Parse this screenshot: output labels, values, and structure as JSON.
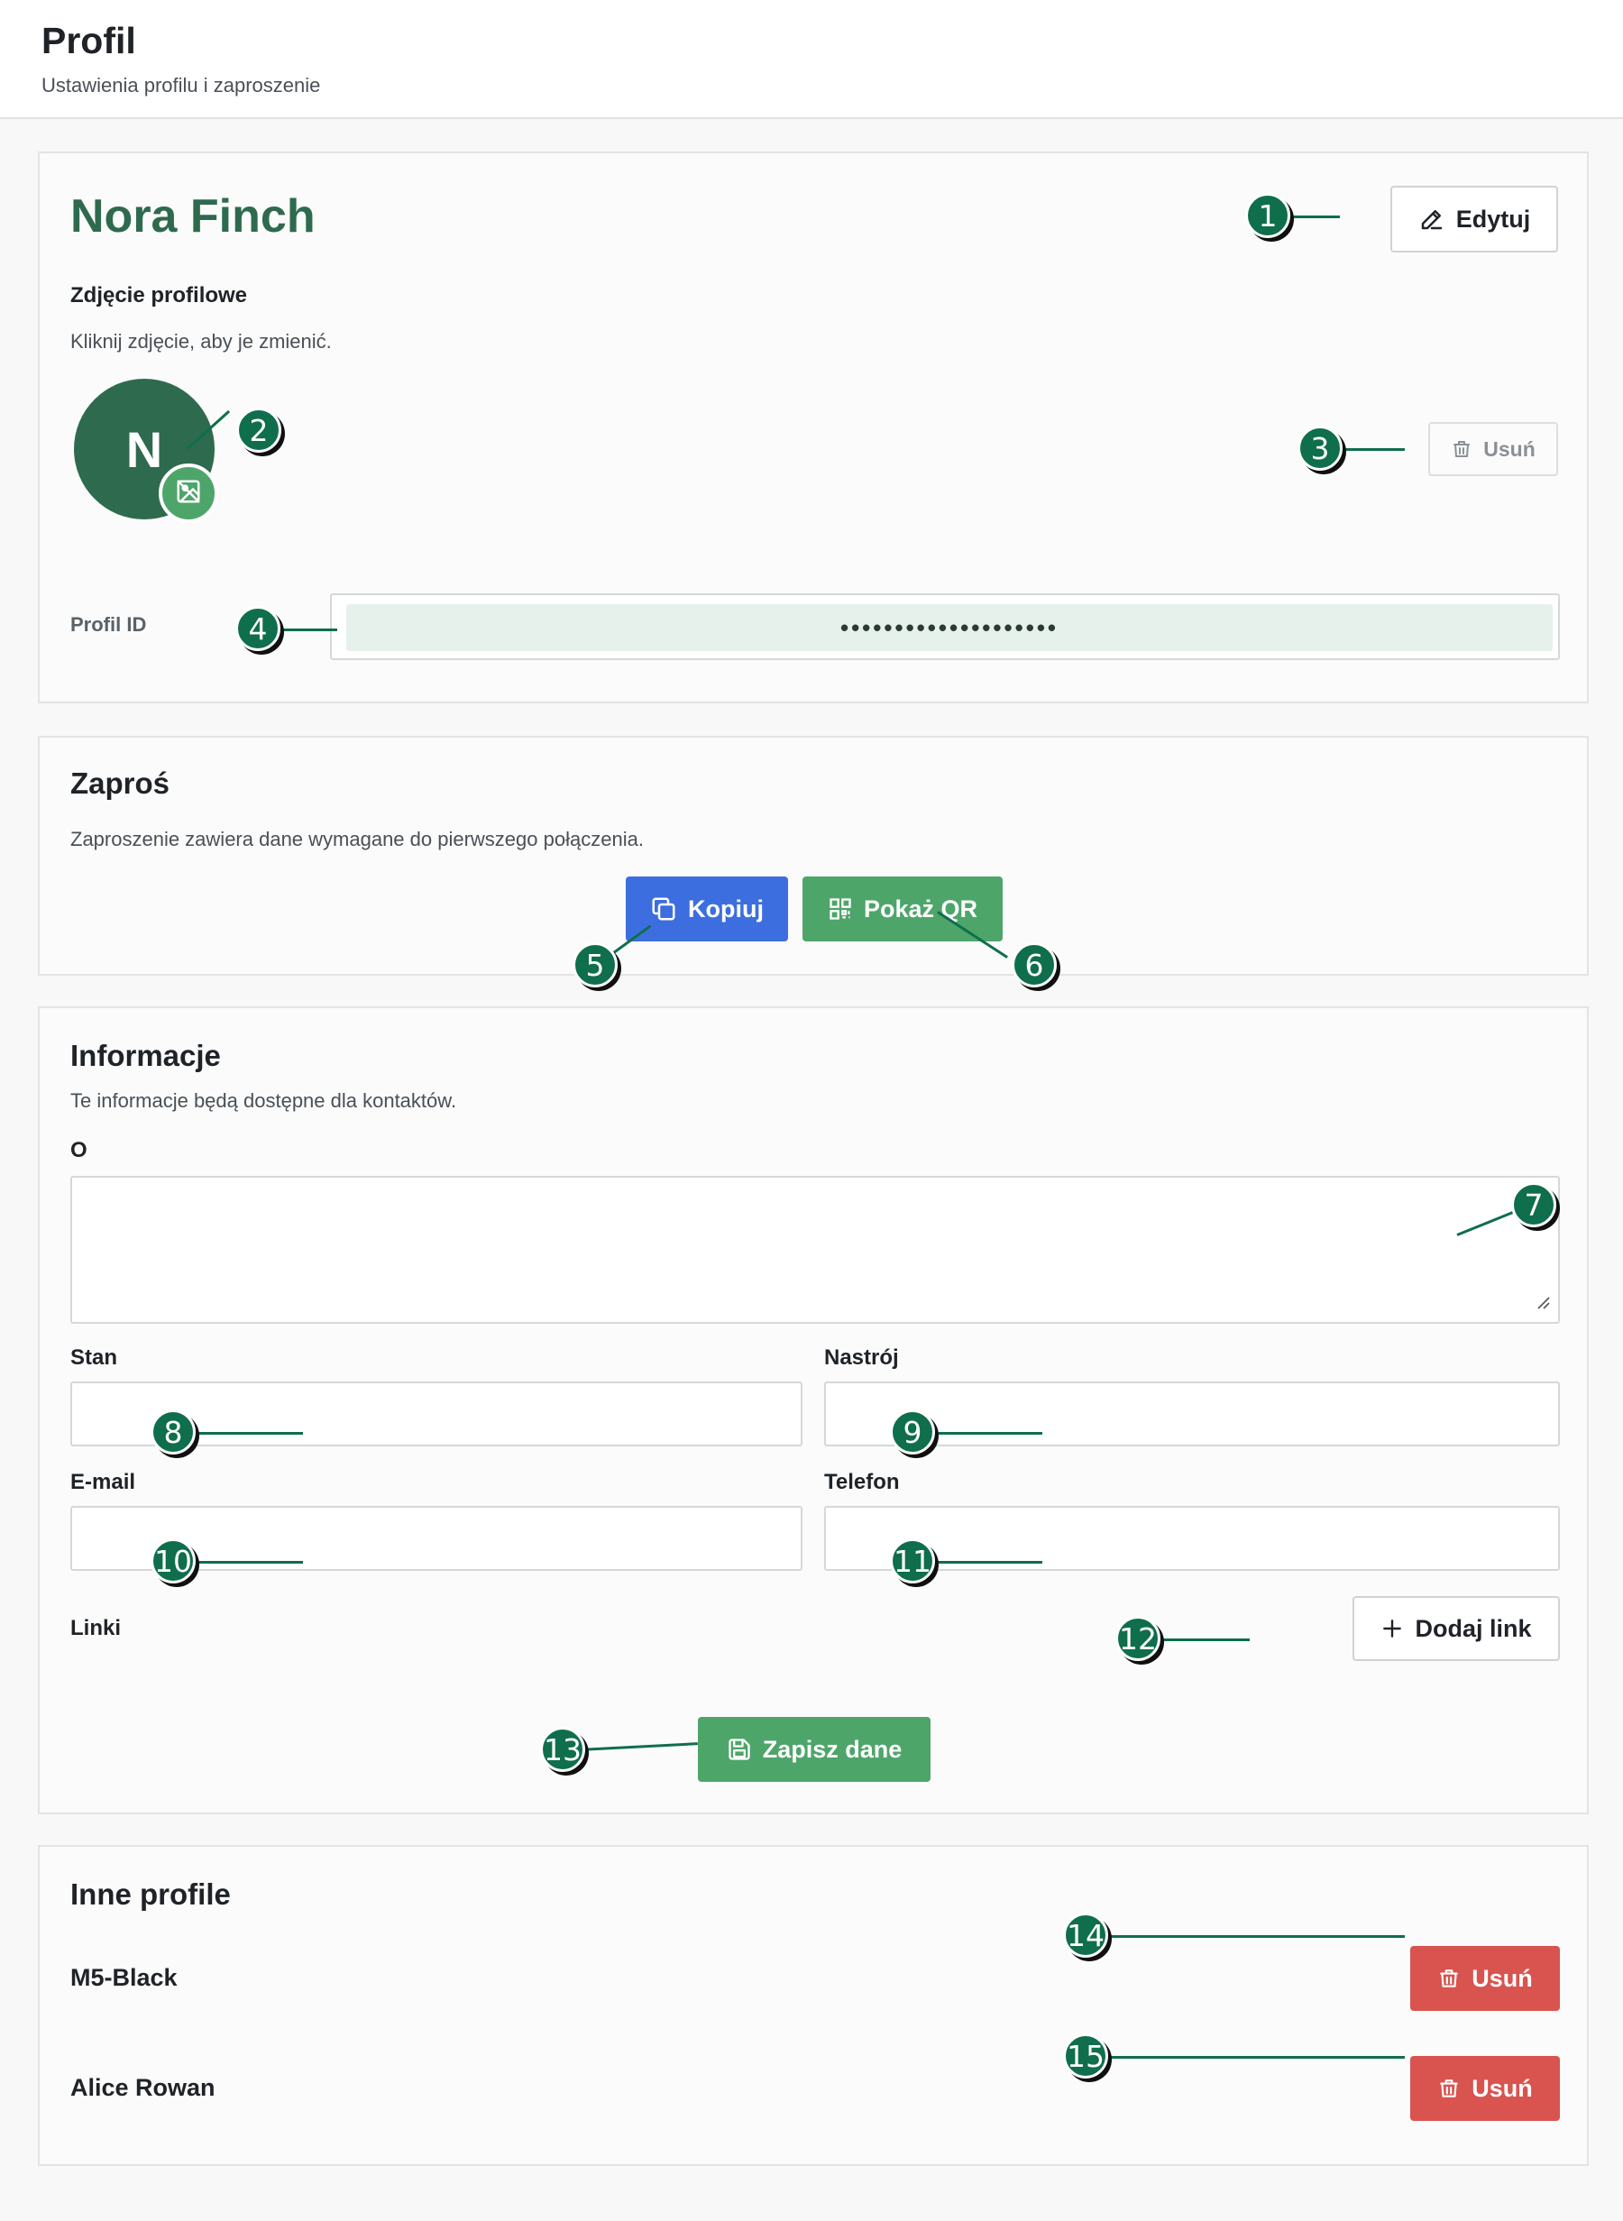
{
  "header": {
    "title": "Profil",
    "subtitle": "Ustawienia profilu i zaproszenie"
  },
  "profile": {
    "name": "Nora Finch",
    "edit_label": "Edytuj",
    "photo_heading": "Zdjęcie profilowe",
    "photo_hint": "Kliknij zdjęcie, aby je zmienić.",
    "avatar_initial": "N",
    "remove_photo_label": "Usuń",
    "id_label": "Profil ID",
    "id_value": "••••••••••••••••••••"
  },
  "invite": {
    "heading": "Zaproś",
    "description": "Zaproszenie zawiera dane wymagane do pierwszego połączenia.",
    "copy_label": "Kopiuj",
    "qr_label": "Pokaż QR"
  },
  "info": {
    "heading": "Informacje",
    "description": "Te informacje będą dostępne dla kontaktów.",
    "about_label": "O",
    "about_value": "",
    "status_label": "Stan",
    "status_value": "",
    "mood_label": "Nastrój",
    "mood_value": "",
    "email_label": "E-mail",
    "email_value": "",
    "phone_label": "Telefon",
    "phone_value": "",
    "links_label": "Linki",
    "add_link_label": "Dodaj link",
    "save_label": "Zapisz dane"
  },
  "others": {
    "heading": "Inne profile",
    "items": [
      {
        "name": "M5-Black",
        "remove_label": "Usuń"
      },
      {
        "name": "Alice Rowan",
        "remove_label": "Usuń"
      }
    ]
  },
  "markers": [
    "1",
    "2",
    "3",
    "4",
    "5",
    "6",
    "7",
    "8",
    "9",
    "10",
    "11",
    "12",
    "13",
    "14",
    "15"
  ],
  "colors": {
    "brand_green": "#2e6a4e",
    "action_green": "#4ea56a",
    "action_blue": "#3d6ee0",
    "danger_red": "#d9534f",
    "marker_green": "#0f6e4c"
  },
  "icons": {
    "edit": "pencil-icon",
    "photo": "image-edit-icon",
    "remove": "trash-icon",
    "copy": "copy-icon",
    "qr": "qr-code-icon",
    "add": "plus-icon",
    "save": "floppy-disk-icon"
  }
}
